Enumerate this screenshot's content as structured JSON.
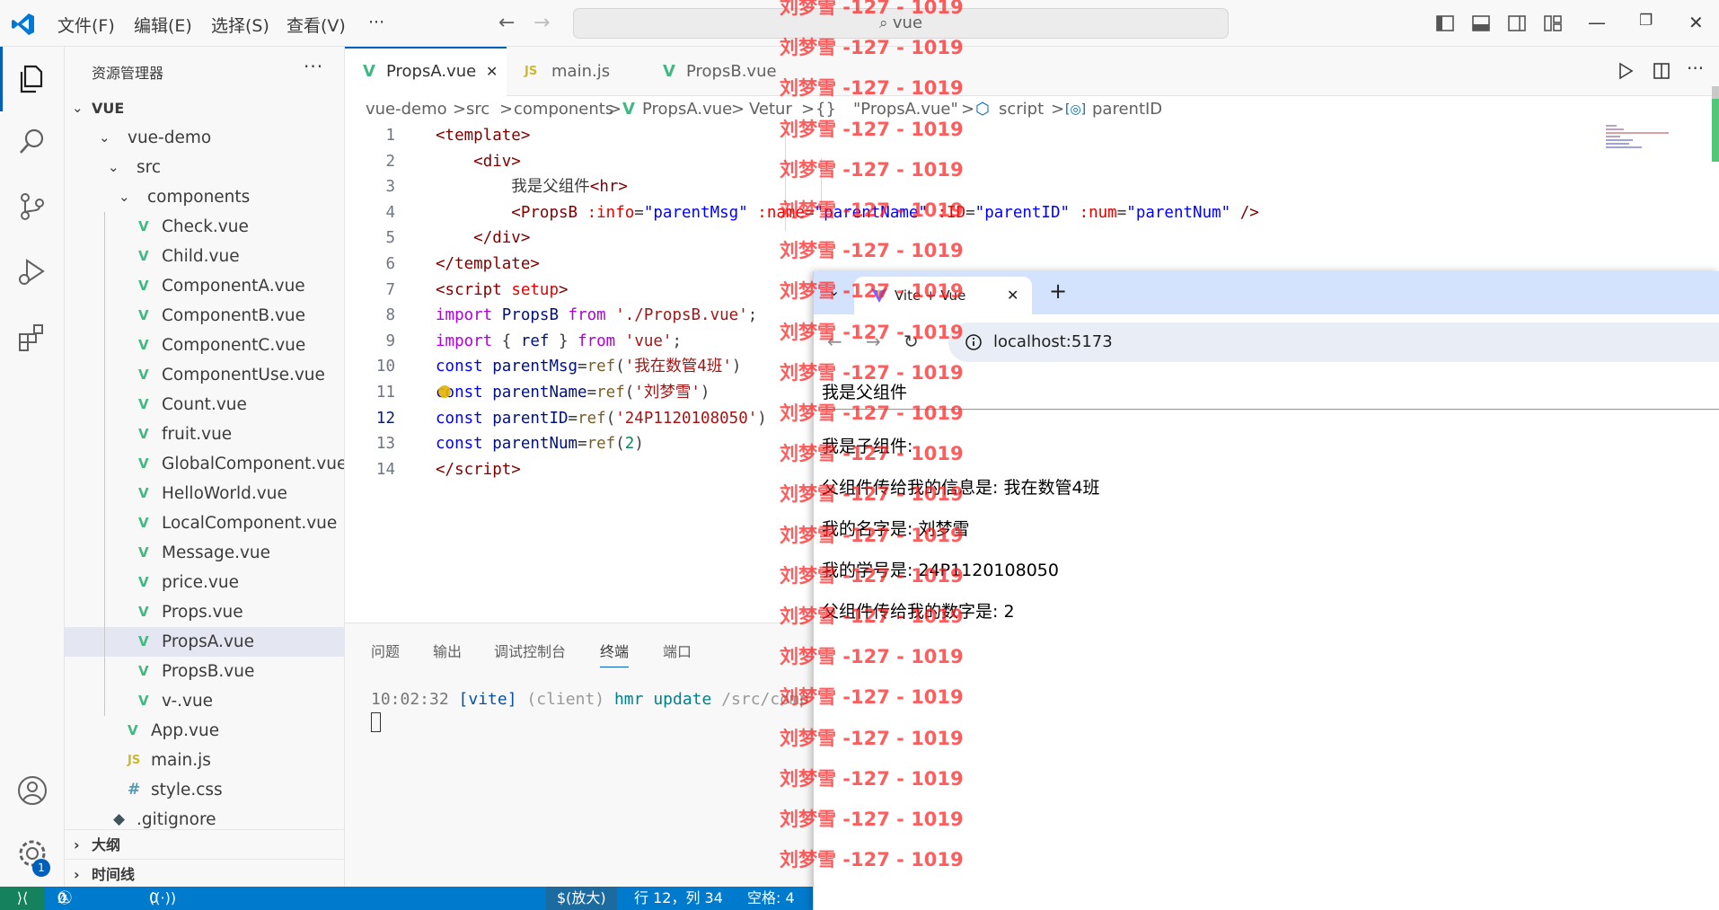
{
  "titlebar": {
    "menus": [
      "文件(F)",
      "编辑(E)",
      "选择(S)",
      "查看(V)"
    ],
    "more": "···",
    "search_text": "vue"
  },
  "activity": {
    "icons": [
      "files-icon",
      "search-icon",
      "source-control-icon",
      "run-debug-icon",
      "extensions-icon",
      "account-icon",
      "manage-gear-icon"
    ],
    "badge": "1"
  },
  "sidebar": {
    "title": "资源管理器",
    "more": "···",
    "root": "VUE",
    "tree": [
      {
        "label": "vue-demo",
        "kind": "folder"
      },
      {
        "label": "src",
        "kind": "folder"
      },
      {
        "label": "components",
        "kind": "folder"
      },
      {
        "label": "Check.vue",
        "kind": "vue"
      },
      {
        "label": "Child.vue",
        "kind": "vue"
      },
      {
        "label": "ComponentA.vue",
        "kind": "vue"
      },
      {
        "label": "ComponentB.vue",
        "kind": "vue"
      },
      {
        "label": "ComponentC.vue",
        "kind": "vue"
      },
      {
        "label": "ComponentUse.vue",
        "kind": "vue"
      },
      {
        "label": "Count.vue",
        "kind": "vue"
      },
      {
        "label": "fruit.vue",
        "kind": "vue"
      },
      {
        "label": "GlobalComponent.vue",
        "kind": "vue"
      },
      {
        "label": "HelloWorld.vue",
        "kind": "vue"
      },
      {
        "label": "LocalComponent.vue",
        "kind": "vue"
      },
      {
        "label": "Message.vue",
        "kind": "vue"
      },
      {
        "label": "price.vue",
        "kind": "vue"
      },
      {
        "label": "Props.vue",
        "kind": "vue"
      },
      {
        "label": "PropsA.vue",
        "kind": "vue"
      },
      {
        "label": "PropsB.vue",
        "kind": "vue"
      },
      {
        "label": "v-.vue",
        "kind": "vue"
      },
      {
        "label": "App.vue",
        "kind": "vue"
      },
      {
        "label": "main.js",
        "kind": "js"
      },
      {
        "label": "style.css",
        "kind": "css"
      },
      {
        "label": ".gitignore",
        "kind": "git"
      }
    ],
    "sections": [
      "大纲",
      "时间线"
    ]
  },
  "editor": {
    "tabs": [
      {
        "label": "PropsA.vue",
        "icon": "V",
        "close": "✕"
      },
      {
        "label": "main.js",
        "icon": "JS"
      },
      {
        "label": "PropsB.vue",
        "icon": "V"
      }
    ],
    "breadcrumb": [
      "vue-demo",
      ">",
      "src",
      ">",
      "components",
      ">",
      "PropsA.vue",
      ">",
      "Vetur",
      ">",
      "{}",
      "\"PropsA.vue\"",
      ">",
      "script",
      ">",
      "parentID"
    ],
    "line_numbers": [
      "1",
      "2",
      "3",
      "4",
      "5",
      "6",
      "7",
      "8",
      "9",
      "10",
      "11",
      "12",
      "13",
      "14"
    ]
  },
  "panel": {
    "tabs": [
      "问题",
      "输出",
      "调试控制台",
      "终端",
      "端口"
    ],
    "terminal_time": "10:02:32",
    "terminal_vite": "[vite]",
    "terminal_client": "(client)",
    "terminal_msg": "hmr update",
    "terminal_path": "/src/comp"
  },
  "statusbar": {
    "errors": "0",
    "warnings": "0",
    "ports": "0",
    "zoom": "$(放大)",
    "position": "行 12，列 34",
    "spaces": "空格: 4"
  },
  "browser": {
    "tab_title": "Vite + Vue",
    "tab_close": "✕",
    "new_tab": "+",
    "url": "localhost:5173",
    "content": [
      "我是父组件",
      "我是子组件:",
      "父组件传给我的信息是: 我在数管4班",
      "我的名字是: 刘梦雪",
      "我的学号是: 24P1120108050",
      "父组件传给我的数字是: 2"
    ]
  },
  "watermark": "刘梦雪 -127 - 1019"
}
